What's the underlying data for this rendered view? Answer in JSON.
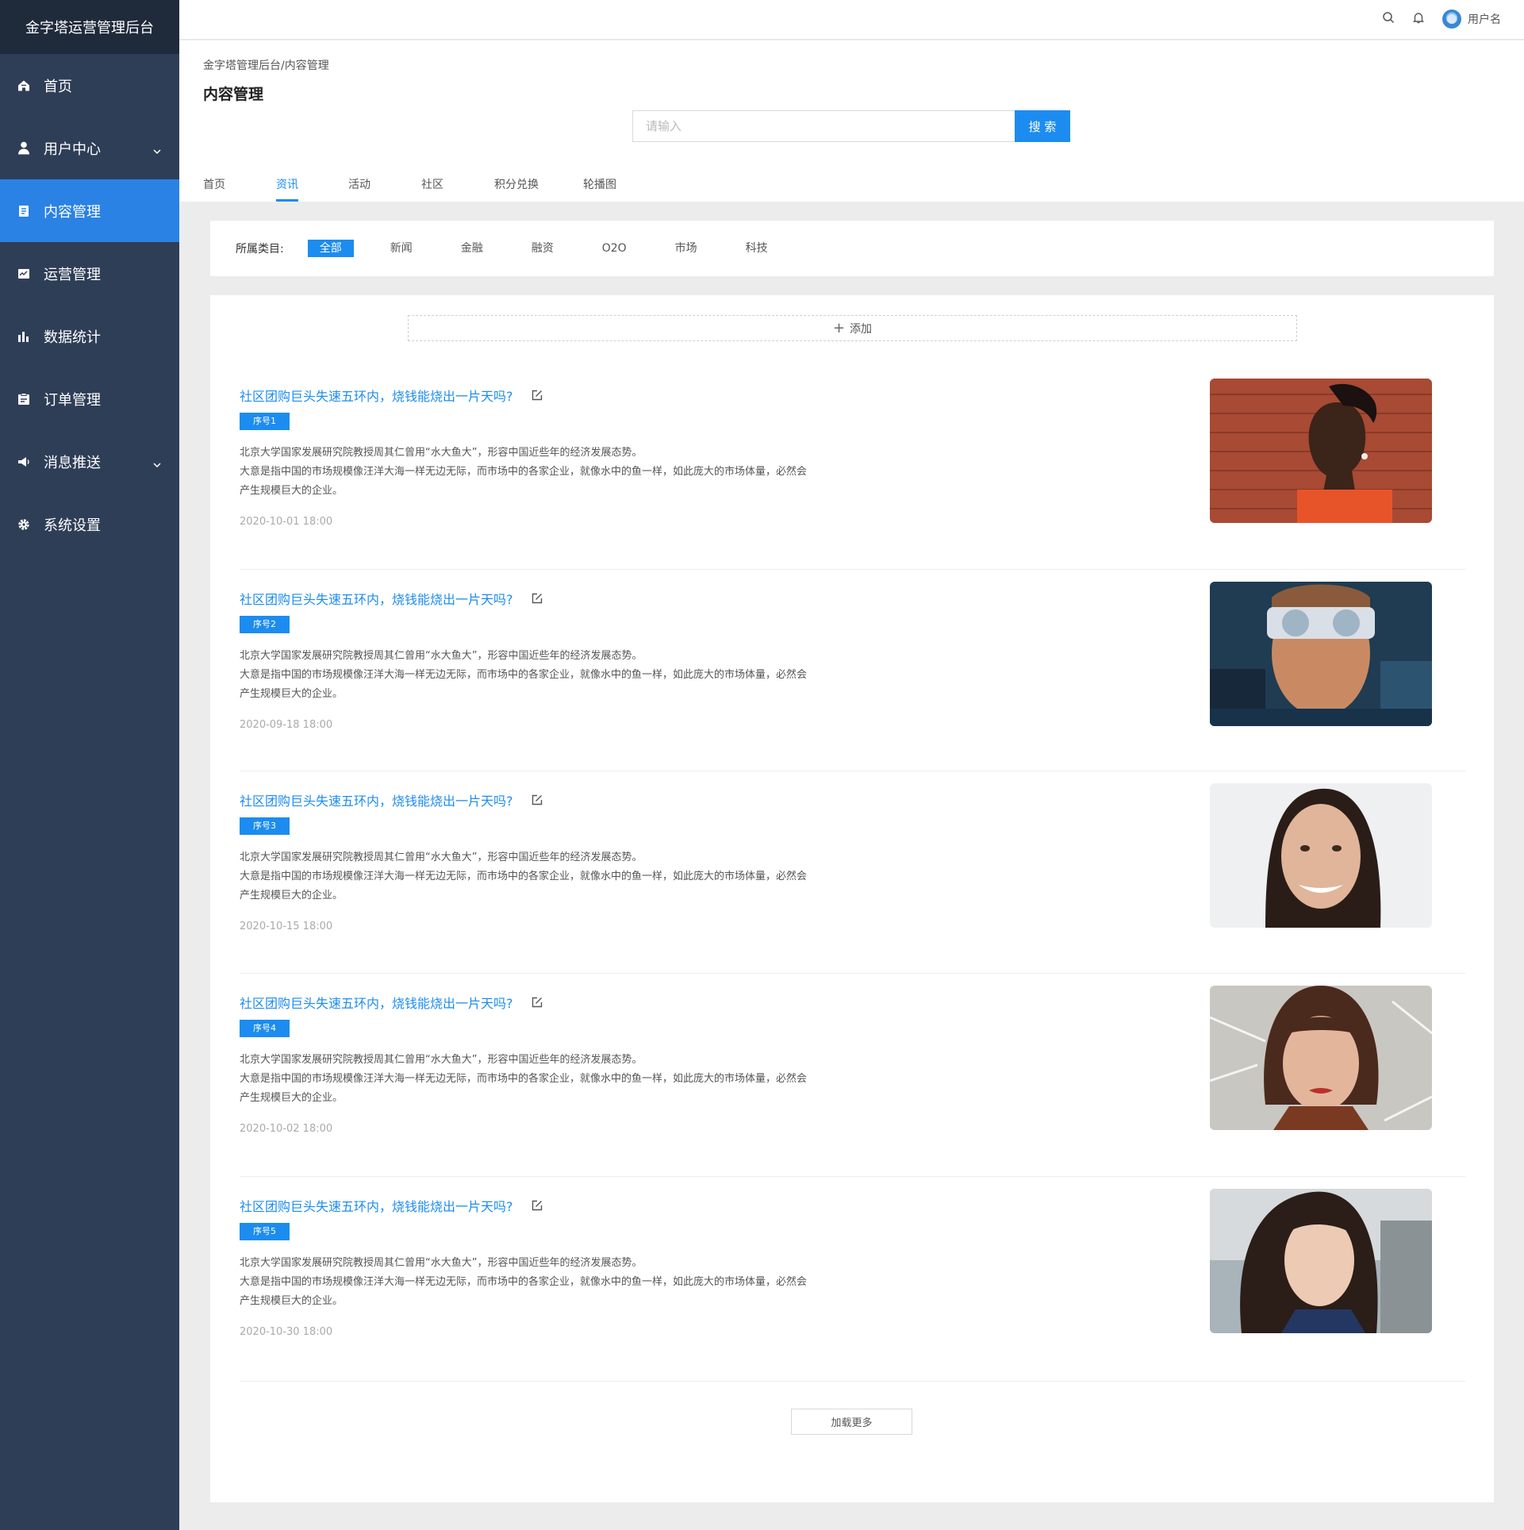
{
  "sidebar": {
    "brand": "金字塔运营管理后台",
    "items": [
      {
        "label": "首页",
        "icon": "home-icon"
      },
      {
        "label": "用户中心",
        "icon": "user-icon",
        "expandable": true
      },
      {
        "label": "内容管理",
        "icon": "document-icon",
        "active": true
      },
      {
        "label": "运营管理",
        "icon": "operation-icon"
      },
      {
        "label": "数据统计",
        "icon": "bar-chart-icon"
      },
      {
        "label": "订单管理",
        "icon": "clipboard-icon"
      },
      {
        "label": "消息推送",
        "icon": "megaphone-icon",
        "expandable": true
      },
      {
        "label": "系统设置",
        "icon": "gear-icon"
      }
    ]
  },
  "topbar": {
    "username": "用户名"
  },
  "header": {
    "breadcrumb": "金字塔管理后台/内容管理",
    "title": "内容管理",
    "search_placeholder": "请输入",
    "search_button": "搜 索",
    "tabs": [
      "首页",
      "资讯",
      "活动",
      "社区",
      "积分兑换",
      "轮播图"
    ],
    "active_tab": "资讯"
  },
  "filter": {
    "label": "所属类目:",
    "chips": [
      "全部",
      "新闻",
      "金融",
      "融资",
      "O2O",
      "市场",
      "科技"
    ],
    "active": "全部"
  },
  "panel": {
    "add_label": "添加",
    "load_more": "加载更多",
    "articles": [
      {
        "title": "社区团购巨头失速五环内，烧钱能烧出一片天吗?",
        "tag": "序号1",
        "desc_line1": "北京大学国家发展研究院教授周其仁曾用“水大鱼大”，形容中国近些年的经济发展态势。",
        "desc_line2": "大意是指中国的市场规模像汪洋大海一样无边无际，而市场中的各家企业，就像水中的鱼一样，如此庞大的市场体量，必然会产生规模巨大的企业。",
        "date": "2020-10-01 18:00"
      },
      {
        "title": "社区团购巨头失速五环内，烧钱能烧出一片天吗?",
        "tag": "序号2",
        "desc_line1": "北京大学国家发展研究院教授周其仁曾用“水大鱼大”，形容中国近些年的经济发展态势。",
        "desc_line2": "大意是指中国的市场规模像汪洋大海一样无边无际，而市场中的各家企业，就像水中的鱼一样，如此庞大的市场体量，必然会产生规模巨大的企业。",
        "date": "2020-09-18 18:00"
      },
      {
        "title": "社区团购巨头失速五环内，烧钱能烧出一片天吗?",
        "tag": "序号3",
        "desc_line1": "北京大学国家发展研究院教授周其仁曾用“水大鱼大”，形容中国近些年的经济发展态势。",
        "desc_line2": "大意是指中国的市场规模像汪洋大海一样无边无际，而市场中的各家企业，就像水中的鱼一样，如此庞大的市场体量，必然会产生规模巨大的企业。",
        "date": "2020-10-15 18:00"
      },
      {
        "title": "社区团购巨头失速五环内，烧钱能烧出一片天吗?",
        "tag": "序号4",
        "desc_line1": "北京大学国家发展研究院教授周其仁曾用“水大鱼大”，形容中国近些年的经济发展态势。",
        "desc_line2": "大意是指中国的市场规模像汪洋大海一样无边无际，而市场中的各家企业，就像水中的鱼一样，如此庞大的市场体量，必然会产生规模巨大的企业。",
        "date": "2020-10-02 18:00"
      },
      {
        "title": "社区团购巨头失速五环内，烧钱能烧出一片天吗?",
        "tag": "序号5",
        "desc_line1": "北京大学国家发展研究院教授周其仁曾用“水大鱼大”，形容中国近些年的经济发展态势。",
        "desc_line2": "大意是指中国的市场规模像汪洋大海一样无边无际，而市场中的各家企业，就像水中的鱼一样，如此庞大的市场体量，必然会产生规模巨大的企业。",
        "date": "2020-10-30 18:00"
      }
    ]
  },
  "colors": {
    "accent": "#1c8cf0",
    "sidebar_bg": "#2f3e57",
    "sidebar_active": "#2a82e4",
    "brand_bg": "#1f2a3b"
  }
}
